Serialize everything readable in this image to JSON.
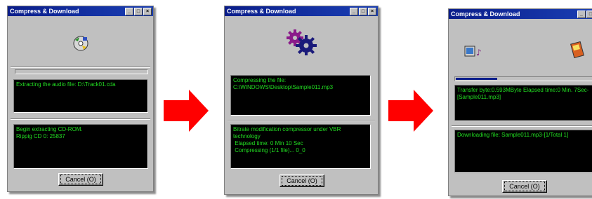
{
  "windows": [
    {
      "title": "Compress & Download",
      "title_buttons": [
        "_",
        "□",
        "×"
      ],
      "icon": "cd-disc-icon",
      "progress": 0,
      "console_top": "Extracting the audio file: D:\\Track01.cda",
      "console_bottom": "Begin extracting CD-ROM.\nRippig CD 0: 25837",
      "cancel_label": "Cancel (O)"
    },
    {
      "title": "Compress & Download",
      "title_buttons": [
        "_",
        "□",
        "×"
      ],
      "icon": "gears-icon",
      "console_top": "Compressing the file:\nC:\\WINDOWS\\Desktop\\Sample011.mp3",
      "console_bottom": "Bitrate modification compressor under VBR technology\n Elapsed time: 0 Min 10 Sec\n Compressing (1/1 file)... 0_0",
      "cancel_label": "Cancel (O)"
    },
    {
      "title": "Compress & Download",
      "title_buttons": [
        "_",
        "□"
      ],
      "icon_left": "computer-music-icon",
      "icon_right": "mp3-player-icon",
      "progress": 0.3,
      "console_top": "Transfer byte:0.593MByte Elapsed time:0 Min. 7Sec-[Sample011.mp3]",
      "console_bottom": "Downloading file: Sample011.mp3-[1/Total 1]",
      "cancel_label": "Cancel (O)"
    }
  ],
  "colors": {
    "arrow": "#ff0000",
    "console_text": "#22dd22",
    "titlebar": "#0a1d8a"
  }
}
